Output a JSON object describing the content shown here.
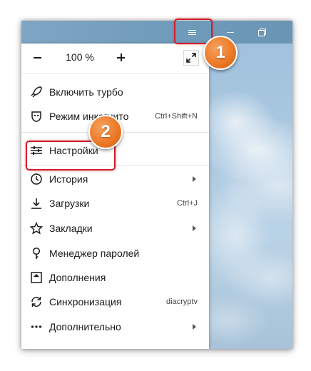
{
  "menu": {
    "zoom": {
      "value": "100 %",
      "minus": "−",
      "plus": "+"
    },
    "items": [
      {
        "label": "Включить турбо",
        "icon": "rocket-icon",
        "shortcut": "",
        "submenu": false
      },
      {
        "label": "Режим инкогнито",
        "icon": "incognito-mask-icon",
        "shortcut": "Ctrl+Shift+N",
        "submenu": false
      },
      {
        "label": "Настройки",
        "icon": "settings-sliders-icon",
        "shortcut": "",
        "submenu": false
      },
      {
        "label": "История",
        "icon": "history-clock-icon",
        "shortcut": "",
        "submenu": true
      },
      {
        "label": "Загрузки",
        "icon": "download-icon",
        "shortcut": "Ctrl+J",
        "submenu": false
      },
      {
        "label": "Закладки",
        "icon": "star-icon",
        "shortcut": "",
        "submenu": true
      },
      {
        "label": "Менеджер паролей",
        "icon": "key-icon",
        "shortcut": "",
        "submenu": false
      },
      {
        "label": "Дополнения",
        "icon": "extensions-icon",
        "shortcut": "",
        "submenu": false
      },
      {
        "label": "Синхронизация",
        "icon": "sync-icon",
        "shortcut": "diacryptv",
        "submenu": false
      },
      {
        "label": "Дополнительно",
        "icon": "more-dots-icon",
        "shortcut": "",
        "submenu": true
      }
    ]
  },
  "annotations": {
    "badge1": "1",
    "badge2": "2",
    "accent": "#d21d2a",
    "badge_color": "#ec7a28"
  }
}
